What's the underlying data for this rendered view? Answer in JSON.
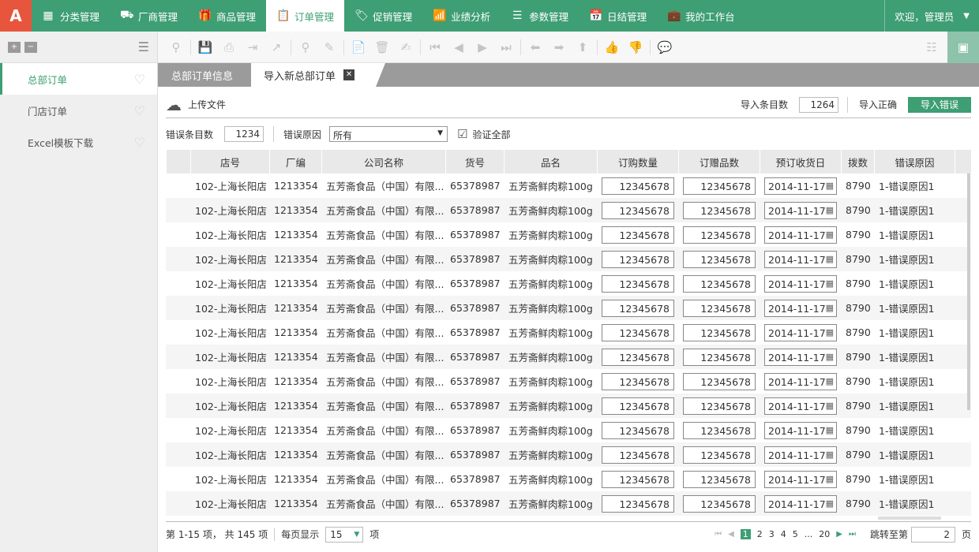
{
  "nav": {
    "logo": "A",
    "items": [
      {
        "label": "分类管理",
        "icon": "grid-icon",
        "glyph": "▦"
      },
      {
        "label": "厂商管理",
        "icon": "cart-icon",
        "glyph": "⛟"
      },
      {
        "label": "商品管理",
        "icon": "gift-icon",
        "glyph": "🎁"
      },
      {
        "label": "订单管理",
        "icon": "clipboard-icon",
        "glyph": "📋"
      },
      {
        "label": "促销管理",
        "icon": "tag-icon",
        "glyph": "🏷"
      },
      {
        "label": "业绩分析",
        "icon": "chart-icon",
        "glyph": "📶"
      },
      {
        "label": "参数管理",
        "icon": "database-icon",
        "glyph": "☰"
      },
      {
        "label": "日结管理",
        "icon": "calendar-icon",
        "glyph": "📅"
      },
      {
        "label": "我的工作台",
        "icon": "briefcase-icon",
        "glyph": "💼"
      }
    ],
    "active_index": 3,
    "welcome": "欢迎，管理员"
  },
  "sidebar": {
    "items": [
      {
        "label": "总部订单",
        "active": true
      },
      {
        "label": "门店订单",
        "active": false
      },
      {
        "label": "Excel模板下载",
        "active": false
      }
    ]
  },
  "tabs": {
    "tab1": "总部订单信息",
    "tab2": "导入新总部订单"
  },
  "upload": {
    "label": "上传文件",
    "import_count_label": "导入条目数",
    "import_count": "1264",
    "import_ok": "导入正确",
    "import_error": "导入错误"
  },
  "filter": {
    "error_count_label": "错误条目数",
    "error_count": "1234",
    "error_reason_label": "错误原因",
    "error_reason_value": "所有",
    "verify_all": "验证全部"
  },
  "table": {
    "headers": [
      "店号",
      "厂编",
      "公司名称",
      "货号",
      "品名",
      "订购数量",
      "订赠品数",
      "预订收货日",
      "拨数",
      "错误原因"
    ],
    "rows": [
      [
        "102-上海长阳店",
        "1213354",
        "五芳斋食品（中国）有限...",
        "65378987",
        "五芳斋鲜肉粽100g",
        "12345678",
        "12345678",
        "2014-11-17",
        "8790",
        "1-错误原因1"
      ],
      [
        "102-上海长阳店",
        "1213354",
        "五芳斋食品（中国）有限...",
        "65378987",
        "五芳斋鲜肉粽100g",
        "12345678",
        "12345678",
        "2014-11-17",
        "8790",
        "1-错误原因1"
      ],
      [
        "102-上海长阳店",
        "1213354",
        "五芳斋食品（中国）有限...",
        "65378987",
        "五芳斋鲜肉粽100g",
        "12345678",
        "12345678",
        "2014-11-17",
        "8790",
        "1-错误原因1"
      ],
      [
        "102-上海长阳店",
        "1213354",
        "五芳斋食品（中国）有限...",
        "65378987",
        "五芳斋鲜肉粽100g",
        "12345678",
        "12345678",
        "2014-11-17",
        "8790",
        "1-错误原因1"
      ],
      [
        "102-上海长阳店",
        "1213354",
        "五芳斋食品（中国）有限...",
        "65378987",
        "五芳斋鲜肉粽100g",
        "12345678",
        "12345678",
        "2014-11-17",
        "8790",
        "1-错误原因1"
      ],
      [
        "102-上海长阳店",
        "1213354",
        "五芳斋食品（中国）有限...",
        "65378987",
        "五芳斋鲜肉粽100g",
        "12345678",
        "12345678",
        "2014-11-17",
        "8790",
        "1-错误原因1"
      ],
      [
        "102-上海长阳店",
        "1213354",
        "五芳斋食品（中国）有限...",
        "65378987",
        "五芳斋鲜肉粽100g",
        "12345678",
        "12345678",
        "2014-11-17",
        "8790",
        "1-错误原因1"
      ],
      [
        "102-上海长阳店",
        "1213354",
        "五芳斋食品（中国）有限...",
        "65378987",
        "五芳斋鲜肉粽100g",
        "12345678",
        "12345678",
        "2014-11-17",
        "8790",
        "1-错误原因1"
      ],
      [
        "102-上海长阳店",
        "1213354",
        "五芳斋食品（中国）有限...",
        "65378987",
        "五芳斋鲜肉粽100g",
        "12345678",
        "12345678",
        "2014-11-17",
        "8790",
        "1-错误原因1"
      ],
      [
        "102-上海长阳店",
        "1213354",
        "五芳斋食品（中国）有限...",
        "65378987",
        "五芳斋鲜肉粽100g",
        "12345678",
        "12345678",
        "2014-11-17",
        "8790",
        "1-错误原因1"
      ],
      [
        "102-上海长阳店",
        "1213354",
        "五芳斋食品（中国）有限...",
        "65378987",
        "五芳斋鲜肉粽100g",
        "12345678",
        "12345678",
        "2014-11-17",
        "8790",
        "1-错误原因1"
      ],
      [
        "102-上海长阳店",
        "1213354",
        "五芳斋食品（中国）有限...",
        "65378987",
        "五芳斋鲜肉粽100g",
        "12345678",
        "12345678",
        "2014-11-17",
        "8790",
        "1-错误原因1"
      ],
      [
        "102-上海长阳店",
        "1213354",
        "五芳斋食品（中国）有限...",
        "65378987",
        "五芳斋鲜肉粽100g",
        "12345678",
        "12345678",
        "2014-11-17",
        "8790",
        "1-错误原因1"
      ],
      [
        "102-上海长阳店",
        "1213354",
        "五芳斋食品（中国）有限...",
        "65378987",
        "五芳斋鲜肉粽100g",
        "12345678",
        "12345678",
        "2014-11-17",
        "8790",
        "1-错误原因1"
      ]
    ]
  },
  "pager": {
    "summary": "第 1-15 项， 共 145 项",
    "per_page_label": "每页显示",
    "per_page": "15",
    "unit": "项",
    "pages": [
      "1",
      "2",
      "3",
      "4",
      "5",
      "...",
      "20"
    ],
    "current_page": "1",
    "jump_label": "跳转至第",
    "jump_value": "2",
    "page_unit": "页"
  },
  "colors": {
    "primary": "#3e9e74",
    "logo": "#e8553d",
    "tab_bg": "#9b9b9b"
  }
}
